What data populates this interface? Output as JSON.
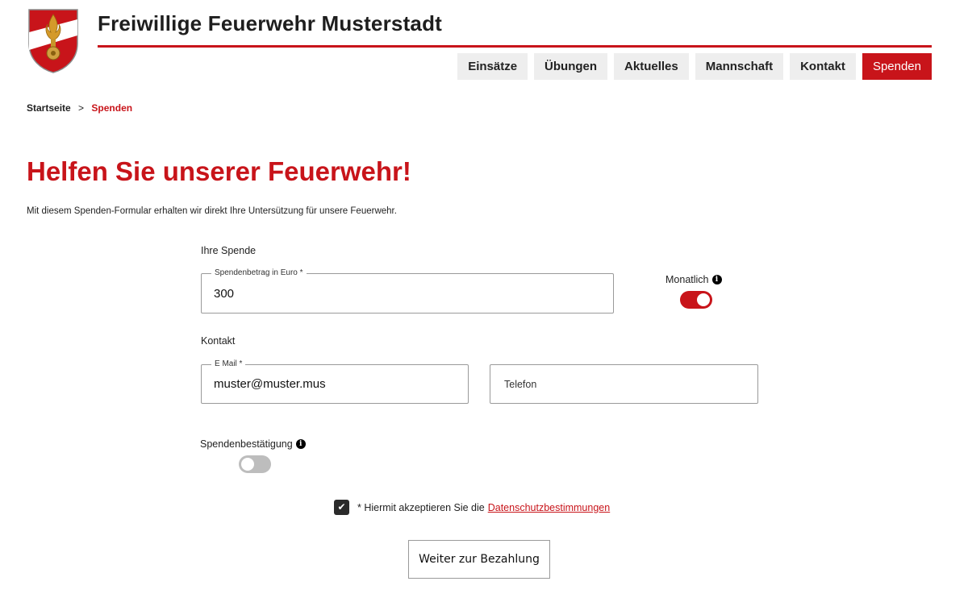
{
  "header": {
    "site_title": "Freiwillige Feuerwehr Musterstadt",
    "brand_color": "#c8141a"
  },
  "nav": {
    "items": [
      {
        "label": "Einsätze",
        "active": false
      },
      {
        "label": "Übungen",
        "active": false
      },
      {
        "label": "Aktuelles",
        "active": false
      },
      {
        "label": "Mannschaft",
        "active": false
      },
      {
        "label": "Kontakt",
        "active": false
      },
      {
        "label": "Spenden",
        "active": true
      }
    ]
  },
  "breadcrumb": {
    "home": "Startseite",
    "separator": ">",
    "current": "Spenden"
  },
  "page": {
    "title": "Helfen Sie unserer Feuerwehr!",
    "intro": "Mit diesem Spenden-Formular erhalten wir direkt Ihre Untersützung für unsere Feuerwehr."
  },
  "form": {
    "donation_section": "Ihre Spende",
    "amount_label": "Spendenbetrag in Euro *",
    "amount_value": "300",
    "monthly_label": "Monatlich",
    "monthly_on": true,
    "contact_section": "Kontakt",
    "email_label": "E Mail *",
    "email_value": "muster@muster.mus",
    "phone_placeholder": "Telefon",
    "confirmation_label": "Spendenbestätigung",
    "confirmation_on": false,
    "consent_text": "* Hiermit akzeptieren Sie die",
    "consent_link": "Datenschutzbestimmungen",
    "consent_checked": true,
    "submit_label": "Weiter zur Bezahlung"
  },
  "icons": {
    "info": "info-icon",
    "check": "check-icon",
    "logo": "fire-brigade-emblem"
  }
}
